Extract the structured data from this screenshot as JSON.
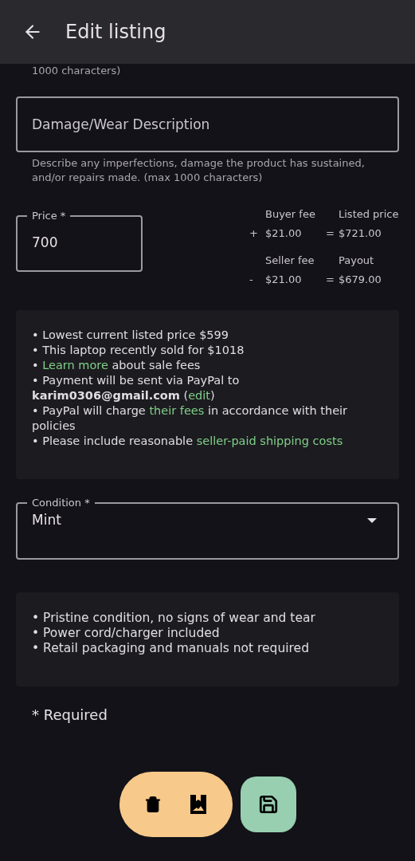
{
  "header": {
    "title": "Edit listing"
  },
  "cut_helper": "1000 characters)",
  "damage_field": {
    "placeholder": "Damage/Wear Description",
    "helper": "Describe any imperfections, damage the product has sustained, and/or repairs made. (max 1000 characters)"
  },
  "price_field": {
    "label": "Price *",
    "value": "700"
  },
  "fees": [
    {
      "operator": "+",
      "label": "Buyer fee",
      "amount": "$21.00",
      "equals": "=",
      "result_label": "Listed price",
      "result": "$721.00"
    },
    {
      "operator": "-",
      "label": "Seller fee",
      "amount": "$21.00",
      "equals": "=",
      "result_label": "Payout",
      "result": "$679.00"
    }
  ],
  "info": [
    [
      {
        "kind": "text",
        "text": "• Lowest current listed price $599"
      }
    ],
    [
      {
        "kind": "text",
        "text": "• This laptop recently sold for $1018"
      }
    ],
    [
      {
        "kind": "text",
        "text": "• "
      },
      {
        "kind": "link",
        "text": "Learn more"
      },
      {
        "kind": "text",
        "text": " about sale fees"
      }
    ],
    [
      {
        "kind": "text",
        "text": "• Payment will be sent via PayPal to **karim0306@gmail.com** ("
      },
      {
        "kind": "link",
        "text": "edit"
      },
      {
        "kind": "text",
        "text": ")"
      }
    ],
    [
      {
        "kind": "text",
        "text": "• PayPal will charge "
      },
      {
        "kind": "link",
        "text": "their fees"
      },
      {
        "kind": "text",
        "text": " in accordance with their policies"
      }
    ],
    [
      {
        "kind": "text",
        "text": "• Please include reasonable "
      },
      {
        "kind": "link",
        "text": "seller-paid shipping costs"
      }
    ]
  ],
  "condition_field": {
    "label": "Condition *",
    "value": "Mint"
  },
  "condition_notes": [
    "• Pristine condition, no signs of wear and tear",
    "• Power cord/charger included",
    "• Retail packaging and manuals not required"
  ],
  "required_note": "* Required"
}
